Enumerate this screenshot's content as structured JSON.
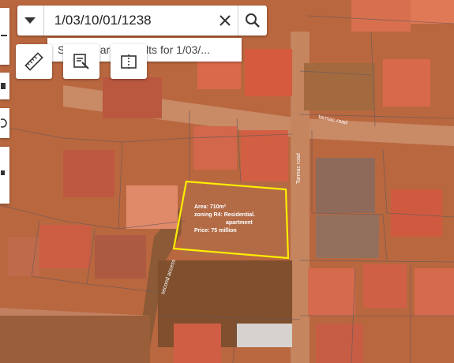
{
  "search": {
    "value": "1/03/10/01/1238",
    "suggestion": "Show search results for 1/03/..."
  },
  "parcel": {
    "area": "Area: 710m²",
    "zoning_line1": "zoning R4: Residential.",
    "zoning_line2": "apartment",
    "price": "Price: 75 million",
    "outline_color": "#ffee00"
  },
  "roads": {
    "tarmac_road_1": "tarmac road",
    "tarmac_road_2": "Tarmac road",
    "second_access": "second access"
  },
  "icons": {
    "dropdown": "chevron-down-icon",
    "clear": "close-icon",
    "search": "search-icon",
    "measure": "ruler-icon",
    "select": "select-edit-icon",
    "compare": "compare-icon"
  }
}
